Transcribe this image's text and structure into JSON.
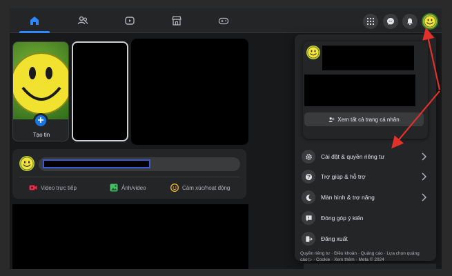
{
  "nav": {
    "tabs": [
      {
        "icon": "home-icon",
        "active": true
      },
      {
        "icon": "friends-icon",
        "active": false
      },
      {
        "icon": "watch-icon",
        "active": false
      },
      {
        "icon": "marketplace-icon",
        "active": false
      },
      {
        "icon": "gaming-icon",
        "active": false
      }
    ],
    "right_buttons": [
      "menu-grid-icon",
      "messenger-icon",
      "notifications-icon",
      "profile-avatar"
    ]
  },
  "stories": {
    "create_label": "Tạo tin"
  },
  "composer": {
    "actions": {
      "video": "Video trực tiếp",
      "photo": "Ảnh/video",
      "feeling": "Cảm xúc/hoạt động"
    }
  },
  "menu": {
    "see_all_profiles": "Xem tất cả trang cá nhân",
    "items": {
      "settings": "Cài đặt & quyền riêng tư",
      "help": "Trợ giúp & hỗ trợ",
      "display": "Màn hình & trợ năng",
      "feedback": "Đóng góp ý kiến",
      "logout": "Đăng xuất"
    },
    "footer": "Quyền riêng tư · Điều khoản · Quảng cáo · Lựa chọn quảng cáo ▷ · Cookie · Xem thêm · Meta © 2024"
  },
  "colors": {
    "accent": "#2d88ff",
    "annotation_arrow": "#e0322a"
  }
}
